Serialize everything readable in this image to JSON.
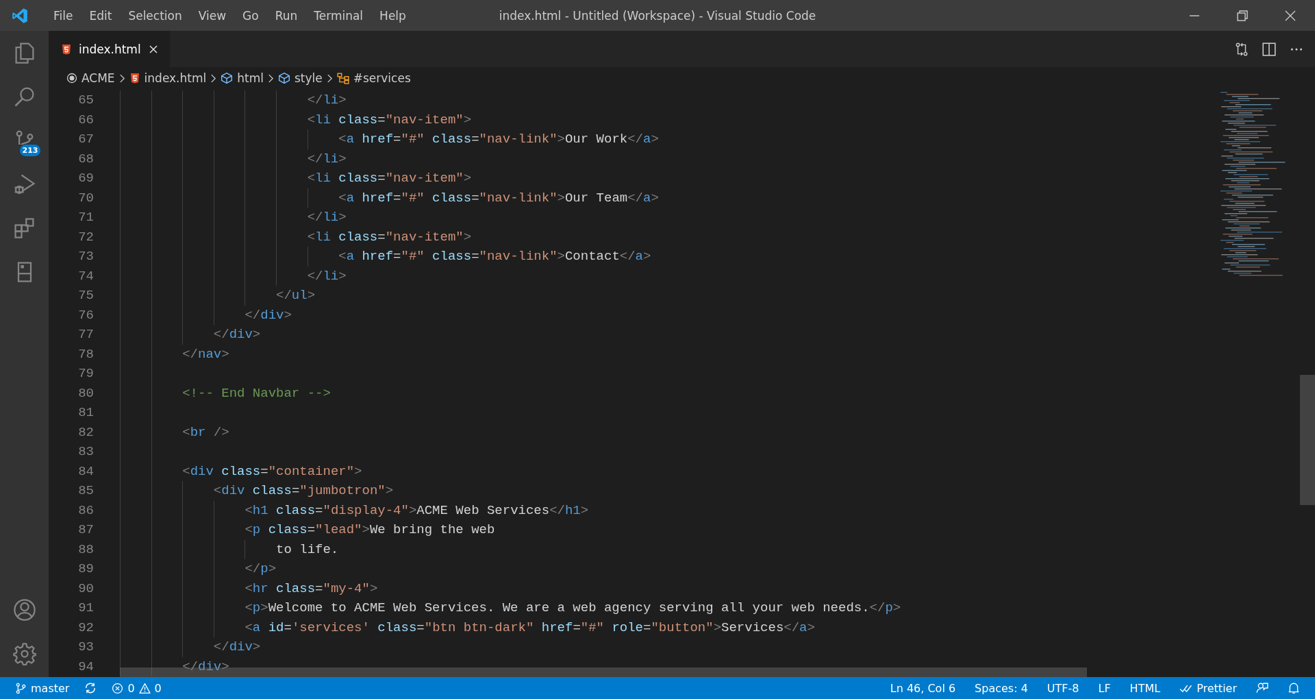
{
  "window": {
    "title": "index.html - Untitled (Workspace) - Visual Studio Code"
  },
  "menu": [
    "File",
    "Edit",
    "Selection",
    "View",
    "Go",
    "Run",
    "Terminal",
    "Help"
  ],
  "activity_bar": {
    "source_control_badge": "213"
  },
  "tabs": [
    {
      "label": "index.html",
      "selected": true
    }
  ],
  "breadcrumbs": [
    {
      "kind": "folder",
      "label": "ACME"
    },
    {
      "kind": "file",
      "label": "index.html"
    },
    {
      "kind": "element",
      "label": "html"
    },
    {
      "kind": "element",
      "label": "style"
    },
    {
      "kind": "selector",
      "label": "#services"
    }
  ],
  "editor": {
    "lines": [
      {
        "number": "65",
        "tokens": [
          {
            "kind": "punct",
            "text": "                        </"
          },
          {
            "kind": "tag",
            "text": "li"
          },
          {
            "kind": "punct",
            "text": ">"
          }
        ]
      },
      {
        "number": "66",
        "tokens": [
          {
            "kind": "punct",
            "text": "                        <"
          },
          {
            "kind": "tag",
            "text": "li"
          },
          {
            "kind": "attr",
            "text": " class"
          },
          {
            "kind": "plain",
            "text": "="
          },
          {
            "kind": "string",
            "text": "\"nav-item\""
          },
          {
            "kind": "punct",
            "text": ">"
          }
        ]
      },
      {
        "number": "67",
        "tokens": [
          {
            "kind": "punct",
            "text": "                            <"
          },
          {
            "kind": "tag",
            "text": "a"
          },
          {
            "kind": "attr",
            "text": " href"
          },
          {
            "kind": "plain",
            "text": "="
          },
          {
            "kind": "string",
            "text": "\"#\""
          },
          {
            "kind": "attr",
            "text": " class"
          },
          {
            "kind": "plain",
            "text": "="
          },
          {
            "kind": "string",
            "text": "\"nav-link\""
          },
          {
            "kind": "punct",
            "text": ">"
          },
          {
            "kind": "plain",
            "text": "Our Work"
          },
          {
            "kind": "punct",
            "text": "</"
          },
          {
            "kind": "tag",
            "text": "a"
          },
          {
            "kind": "punct",
            "text": ">"
          }
        ]
      },
      {
        "number": "68",
        "tokens": [
          {
            "kind": "punct",
            "text": "                        </"
          },
          {
            "kind": "tag",
            "text": "li"
          },
          {
            "kind": "punct",
            "text": ">"
          }
        ]
      },
      {
        "number": "69",
        "tokens": [
          {
            "kind": "punct",
            "text": "                        <"
          },
          {
            "kind": "tag",
            "text": "li"
          },
          {
            "kind": "attr",
            "text": " class"
          },
          {
            "kind": "plain",
            "text": "="
          },
          {
            "kind": "string",
            "text": "\"nav-item\""
          },
          {
            "kind": "punct",
            "text": ">"
          }
        ]
      },
      {
        "number": "70",
        "tokens": [
          {
            "kind": "punct",
            "text": "                            <"
          },
          {
            "kind": "tag",
            "text": "a"
          },
          {
            "kind": "attr",
            "text": " href"
          },
          {
            "kind": "plain",
            "text": "="
          },
          {
            "kind": "string",
            "text": "\"#\""
          },
          {
            "kind": "attr",
            "text": " class"
          },
          {
            "kind": "plain",
            "text": "="
          },
          {
            "kind": "string",
            "text": "\"nav-link\""
          },
          {
            "kind": "punct",
            "text": ">"
          },
          {
            "kind": "plain",
            "text": "Our Team"
          },
          {
            "kind": "punct",
            "text": "</"
          },
          {
            "kind": "tag",
            "text": "a"
          },
          {
            "kind": "punct",
            "text": ">"
          }
        ]
      },
      {
        "number": "71",
        "tokens": [
          {
            "kind": "punct",
            "text": "                        </"
          },
          {
            "kind": "tag",
            "text": "li"
          },
          {
            "kind": "punct",
            "text": ">"
          }
        ]
      },
      {
        "number": "72",
        "tokens": [
          {
            "kind": "punct",
            "text": "                        <"
          },
          {
            "kind": "tag",
            "text": "li"
          },
          {
            "kind": "attr",
            "text": " class"
          },
          {
            "kind": "plain",
            "text": "="
          },
          {
            "kind": "string",
            "text": "\"nav-item\""
          },
          {
            "kind": "punct",
            "text": ">"
          }
        ]
      },
      {
        "number": "73",
        "tokens": [
          {
            "kind": "punct",
            "text": "                            <"
          },
          {
            "kind": "tag",
            "text": "a"
          },
          {
            "kind": "attr",
            "text": " href"
          },
          {
            "kind": "plain",
            "text": "="
          },
          {
            "kind": "string",
            "text": "\"#\""
          },
          {
            "kind": "attr",
            "text": " class"
          },
          {
            "kind": "plain",
            "text": "="
          },
          {
            "kind": "string",
            "text": "\"nav-link\""
          },
          {
            "kind": "punct",
            "text": ">"
          },
          {
            "kind": "plain",
            "text": "Contact"
          },
          {
            "kind": "punct",
            "text": "</"
          },
          {
            "kind": "tag",
            "text": "a"
          },
          {
            "kind": "punct",
            "text": ">"
          }
        ]
      },
      {
        "number": "74",
        "tokens": [
          {
            "kind": "punct",
            "text": "                        </"
          },
          {
            "kind": "tag",
            "text": "li"
          },
          {
            "kind": "punct",
            "text": ">"
          }
        ]
      },
      {
        "number": "75",
        "tokens": [
          {
            "kind": "punct",
            "text": "                    </"
          },
          {
            "kind": "tag",
            "text": "ul"
          },
          {
            "kind": "punct",
            "text": ">"
          }
        ]
      },
      {
        "number": "76",
        "tokens": [
          {
            "kind": "punct",
            "text": "                </"
          },
          {
            "kind": "tag",
            "text": "div"
          },
          {
            "kind": "punct",
            "text": ">"
          }
        ]
      },
      {
        "number": "77",
        "tokens": [
          {
            "kind": "punct",
            "text": "            </"
          },
          {
            "kind": "tag",
            "text": "div"
          },
          {
            "kind": "punct",
            "text": ">"
          }
        ]
      },
      {
        "number": "78",
        "tokens": [
          {
            "kind": "punct",
            "text": "        </"
          },
          {
            "kind": "tag",
            "text": "nav"
          },
          {
            "kind": "punct",
            "text": ">"
          }
        ]
      },
      {
        "number": "79"
      },
      {
        "number": "80",
        "tokens": [
          {
            "kind": "comment",
            "text": "        <!-- End Navbar -->"
          }
        ]
      },
      {
        "number": "81"
      },
      {
        "number": "82",
        "tokens": [
          {
            "kind": "punct",
            "text": "        <"
          },
          {
            "kind": "tag",
            "text": "br"
          },
          {
            "kind": "punct",
            "text": " />"
          }
        ]
      },
      {
        "number": "83"
      },
      {
        "number": "84",
        "tokens": [
          {
            "kind": "punct",
            "text": "        <"
          },
          {
            "kind": "tag",
            "text": "div"
          },
          {
            "kind": "attr",
            "text": " class"
          },
          {
            "kind": "plain",
            "text": "="
          },
          {
            "kind": "string",
            "text": "\"container\""
          },
          {
            "kind": "punct",
            "text": ">"
          }
        ]
      },
      {
        "number": "85",
        "tokens": [
          {
            "kind": "punct",
            "text": "            <"
          },
          {
            "kind": "tag",
            "text": "div"
          },
          {
            "kind": "attr",
            "text": " class"
          },
          {
            "kind": "plain",
            "text": "="
          },
          {
            "kind": "string",
            "text": "\"jumbotron\""
          },
          {
            "kind": "punct",
            "text": ">"
          }
        ]
      },
      {
        "number": "86",
        "tokens": [
          {
            "kind": "punct",
            "text": "                <"
          },
          {
            "kind": "tag",
            "text": "h1"
          },
          {
            "kind": "attr",
            "text": " class"
          },
          {
            "kind": "plain",
            "text": "="
          },
          {
            "kind": "string",
            "text": "\"display-4\""
          },
          {
            "kind": "punct",
            "text": ">"
          },
          {
            "kind": "plain",
            "text": "ACME Web Services"
          },
          {
            "kind": "punct",
            "text": "</"
          },
          {
            "kind": "tag",
            "text": "h1"
          },
          {
            "kind": "punct",
            "text": ">"
          }
        ]
      },
      {
        "number": "87",
        "tokens": [
          {
            "kind": "punct",
            "text": "                <"
          },
          {
            "kind": "tag",
            "text": "p"
          },
          {
            "kind": "attr",
            "text": " class"
          },
          {
            "kind": "plain",
            "text": "="
          },
          {
            "kind": "string",
            "text": "\"lead\""
          },
          {
            "kind": "punct",
            "text": ">"
          },
          {
            "kind": "plain",
            "text": "We bring the web"
          }
        ]
      },
      {
        "number": "88",
        "tokens": [
          {
            "kind": "plain",
            "text": "                    to life."
          }
        ]
      },
      {
        "number": "89",
        "tokens": [
          {
            "kind": "punct",
            "text": "                </"
          },
          {
            "kind": "tag",
            "text": "p"
          },
          {
            "kind": "punct",
            "text": ">"
          }
        ]
      },
      {
        "number": "90",
        "tokens": [
          {
            "kind": "punct",
            "text": "                <"
          },
          {
            "kind": "tag",
            "text": "hr"
          },
          {
            "kind": "attr",
            "text": " class"
          },
          {
            "kind": "plain",
            "text": "="
          },
          {
            "kind": "string",
            "text": "\"my-4\""
          },
          {
            "kind": "punct",
            "text": ">"
          }
        ]
      },
      {
        "number": "91",
        "tokens": [
          {
            "kind": "punct",
            "text": "                <"
          },
          {
            "kind": "tag",
            "text": "p"
          },
          {
            "kind": "punct",
            "text": ">"
          },
          {
            "kind": "plain",
            "text": "Welcome to ACME Web Services. We are a web agency serving all your web needs."
          },
          {
            "kind": "punct",
            "text": "</"
          },
          {
            "kind": "tag",
            "text": "p"
          },
          {
            "kind": "punct",
            "text": ">"
          }
        ]
      },
      {
        "number": "92",
        "tokens": [
          {
            "kind": "punct",
            "text": "                <"
          },
          {
            "kind": "tag",
            "text": "a"
          },
          {
            "kind": "attr",
            "text": " id"
          },
          {
            "kind": "plain",
            "text": "="
          },
          {
            "kind": "string",
            "text": "'services'"
          },
          {
            "kind": "attr",
            "text": " class"
          },
          {
            "kind": "plain",
            "text": "="
          },
          {
            "kind": "string",
            "text": "\"btn btn-dark\""
          },
          {
            "kind": "attr",
            "text": " href"
          },
          {
            "kind": "plain",
            "text": "="
          },
          {
            "kind": "string",
            "text": "\"#\""
          },
          {
            "kind": "attr",
            "text": " role"
          },
          {
            "kind": "plain",
            "text": "="
          },
          {
            "kind": "string",
            "text": "\"button\""
          },
          {
            "kind": "punct",
            "text": ">"
          },
          {
            "kind": "plain",
            "text": "Services"
          },
          {
            "kind": "punct",
            "text": "</"
          },
          {
            "kind": "tag",
            "text": "a"
          },
          {
            "kind": "punct",
            "text": ">"
          }
        ]
      },
      {
        "number": "93",
        "tokens": [
          {
            "kind": "punct",
            "text": "            </"
          },
          {
            "kind": "tag",
            "text": "div"
          },
          {
            "kind": "punct",
            "text": ">"
          }
        ]
      },
      {
        "number": "94",
        "tokens": [
          {
            "kind": "punct",
            "text": "        </"
          },
          {
            "kind": "tag",
            "text": "div"
          },
          {
            "kind": "punct",
            "text": ">"
          }
        ]
      }
    ]
  },
  "status_bar": {
    "branch": "master",
    "errors": "0",
    "warnings": "0",
    "items": [
      "Ln 46, Col 6",
      "Spaces: 4",
      "UTF-8",
      "LF",
      "HTML"
    ],
    "formatter": "Prettier"
  }
}
